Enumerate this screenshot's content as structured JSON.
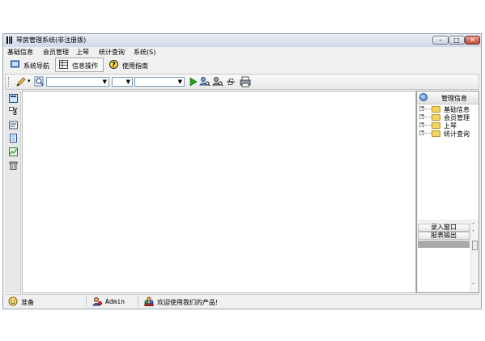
{
  "window": {
    "title": "琴房管理系统(非注册版)",
    "controls": {
      "minimize": "–",
      "maximize": "□",
      "close": "✕"
    }
  },
  "menu": [
    "基础信息",
    "会员管理",
    "上琴",
    "统计查询",
    "系统(S)"
  ],
  "tabs": [
    {
      "label": "系统导航",
      "icon": "navigation-icon",
      "active": false
    },
    {
      "label": "信息操作",
      "icon": "table-icon",
      "active": true
    },
    {
      "label": "使用指南",
      "icon": "help-icon",
      "active": false
    }
  ],
  "toolbar": {
    "icons": [
      "pencil-icon",
      "search-icon",
      "run-icon",
      "find-user-icon",
      "find-icon",
      "strikethrough-icon",
      "print-icon"
    ],
    "combo1_value": "",
    "combo2_value": "",
    "combo3_value": ""
  },
  "left_toolbar": [
    "view-icon",
    "cut-icon",
    "card-icon",
    "document-icon",
    "chart-icon",
    "trash-icon"
  ],
  "right_panel": {
    "title": "管理信息",
    "tree": [
      "基础信息",
      "会员管理",
      "上琴",
      "统计查询"
    ],
    "buttons": [
      "录入窗口",
      "报表输出"
    ]
  },
  "status": {
    "state": "准备",
    "user": "Admin",
    "message": "欢迎使用我们的产品!"
  },
  "colors": {
    "accent": "#2a6bbf",
    "folder": "#f4d35e",
    "selection": "#a9a9a9"
  }
}
